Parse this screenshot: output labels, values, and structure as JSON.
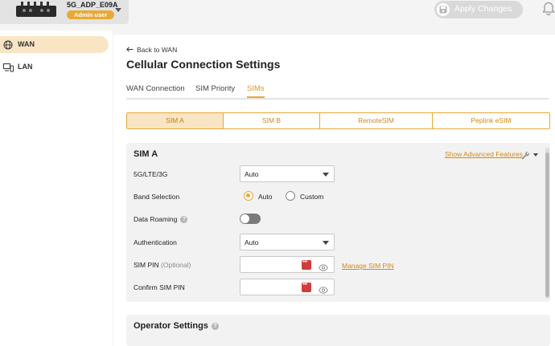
{
  "device": {
    "name": "5G_ADP_E09A",
    "role": "Admin user"
  },
  "header": {
    "apply_label": "Apply Changes"
  },
  "sidebar": {
    "items": [
      {
        "label": "WAN"
      },
      {
        "label": "LAN"
      }
    ]
  },
  "page": {
    "back_label": "Back to WAN",
    "title": "Cellular Connection Settings",
    "tabs": [
      {
        "label": "WAN Connection"
      },
      {
        "label": "SIM Priority"
      },
      {
        "label": "SIMs"
      }
    ],
    "sim_tabs": [
      {
        "label": "SIM A"
      },
      {
        "label": "SIM B"
      },
      {
        "label": "RemoteSIM"
      },
      {
        "label": "Peplink eSIM"
      }
    ]
  },
  "sim_panel": {
    "title": "SIM A",
    "advanced_label": "Show Advanced Features",
    "network_label": "5G/LTE/3G",
    "network_value": "Auto",
    "band_label": "Band Selection",
    "band_auto": "Auto",
    "band_custom": "Custom",
    "roaming_label": "Data Roaming",
    "roaming_help": "?",
    "auth_label": "Authentication",
    "auth_value": "Auto",
    "pin_label": "SIM PIN",
    "pin_optional": "(Optional)",
    "manage_pin": "Manage SIM PIN",
    "confirm_pin_label": "Confirm SIM PIN"
  },
  "operator_panel": {
    "title": "Operator Settings",
    "help": "?"
  },
  "state": {
    "data_roaming_enabled": false,
    "band_selection": "Auto",
    "active_tab": "SIMs",
    "active_sim_tab": "SIM A"
  },
  "colors": {
    "accent": "#e8a935",
    "accent_light": "#f8e5c4"
  }
}
